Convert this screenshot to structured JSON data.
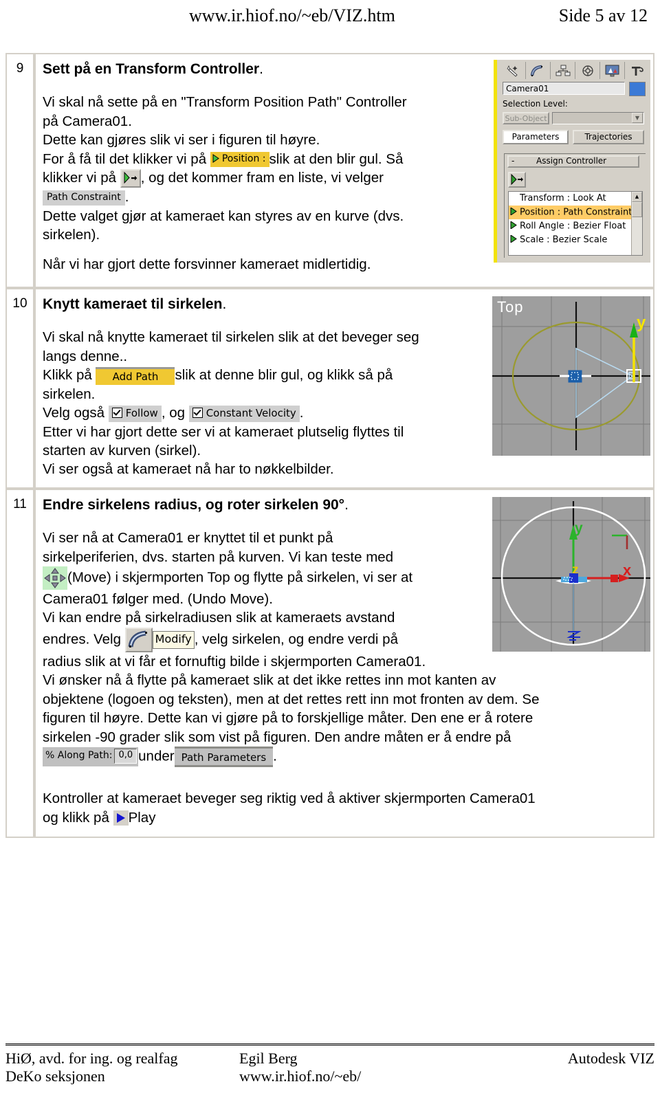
{
  "header": {
    "url": "www.ir.hiof.no/~eb/VIZ.htm",
    "page_label": "Side 5 av 12"
  },
  "steps": [
    {
      "number": "9",
      "title": "Sett på en Transform Controller",
      "title_suffix": ".",
      "lines": [
        "Vi skal nå sette på en \"Transform Position Path\" Controller",
        "på Camera01.",
        "Dette kan gjøres slik vi ser i figuren til høyre.",
        "For å få til det klikker vi på ",
        "slik at den blir gul. Så",
        "klikker vi på ",
        ", og det kommer fram en liste, vi velger",
        ".",
        "Dette valget gjør at kameraet kan styres av en kurve (dvs.",
        "sirkelen).",
        "Når vi har gjort dette forsvinner kameraet midlertidig."
      ],
      "chips": {
        "position_label": "Position :",
        "path_constraint_label": "Path Constraint"
      }
    },
    {
      "number": "10",
      "title": "Knytt kameraet til sirkelen",
      "title_suffix": ".",
      "lines": [
        "Vi skal nå knytte kameraet til sirkelen slik at det beveger seg",
        "langs denne..",
        "Klikk på ",
        "slik at denne blir gul, og klikk så på",
        "sirkelen.",
        "Velg også ",
        ", og ",
        ".",
        "Etter vi har gjort dette ser vi at kameraet plutselig flyttes til",
        "starten av kurven (sirkel).",
        "Vi ser også at kameraet nå har to nøkkelbilder."
      ],
      "chips": {
        "add_path_label": "Add Path",
        "follow_label": "Follow",
        "constant_velocity_label": "Constant Velocity"
      }
    },
    {
      "number": "11",
      "title": "Endre sirkelens radius, og roter sirkelen 90°",
      "title_suffix": ".",
      "lines": [
        "Vi ser nå at Camera01 er knyttet til et punkt på",
        "sirkelperiferien, dvs. starten på kurven. Vi kan teste med",
        "(Move) i skjermporten Top og flytte på sirkelen, vi ser at",
        "Camera01 følger med. (Undo Move).",
        "Vi kan endre på sirkelradiusen slik at kameraets avstand",
        "endres. Velg ",
        ", velg sirkelen, og endre verdi på",
        "radius slik at vi får et fornuftig bilde i skjermporten Camera01.",
        "Vi ønsker nå å flytte på kameraet slik at det ikke rettes inn mot kanten av",
        "objektene (logoen og teksten), men at det rettes rett inn mot fronten av dem. Se",
        "figuren til høyre. Dette kan vi gjøre på to forskjellige måter. Den ene er å rotere",
        "sirkelen -90 grader slik som vist på figuren. Den andre måten er å endre på",
        "under",
        ".",
        "Kontroller at kameraet beveger seg riktig ved å aktiver skjermporten Camera01",
        "og klikk på ",
        "Play."
      ],
      "chips": {
        "modify_label": "Modify",
        "along_path_label": "% Along Path:",
        "along_path_value": "0,0",
        "path_parameters_label": "Path Parameters",
        "play_label": "Play"
      }
    }
  ],
  "figures": {
    "command_panel": {
      "object_name": "Camera01",
      "selection_level_label": "Selection Level:",
      "sub_object_label": "Sub-Object",
      "tab_parameters": "Parameters",
      "tab_trajectories": "Trajectories",
      "rollout_collapse": "-",
      "rollout_title": "Assign Controller",
      "controller_list": [
        {
          "label": "Transform : Look At",
          "selected": false,
          "has_arrow": false
        },
        {
          "label": "Position : Path Constraint",
          "selected": true,
          "has_arrow": true
        },
        {
          "label": "Roll Angle : Bezier Float",
          "selected": false,
          "has_arrow": true
        },
        {
          "label": "Scale : Bezier Scale",
          "selected": false,
          "has_arrow": true
        }
      ],
      "accent_yellow": "#f2e20a",
      "highlight_color": "#ffcc66",
      "swatch_color": "#3c7ad6"
    },
    "viewport_top": {
      "label": "Top",
      "axis_y_label": "y",
      "circle_color": "#9a9a2e",
      "background": "#9e9e9e"
    },
    "viewport_front": {
      "label": "",
      "axis_x_label": "x",
      "axis_y_label": "y",
      "axis_z_label": "z",
      "circle_color": "#ffffff",
      "background": "#9e9e9e"
    }
  },
  "footer": {
    "left_line1": "HiØ, avd. for ing. og realfag",
    "left_line2": "DeKo seksjonen",
    "mid_line1": "Egil Berg",
    "mid_line2": "www.ir.hiof.no/~eb/",
    "right_line1": "Autodesk VIZ",
    "right_line2": ""
  }
}
